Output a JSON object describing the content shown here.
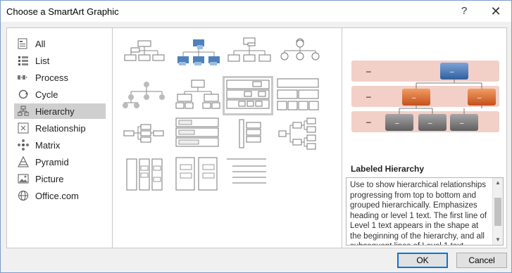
{
  "window": {
    "title": "Choose a SmartArt Graphic",
    "help_glyph": "?",
    "close_glyph": "✕"
  },
  "categories": [
    {
      "label": "All",
      "icon": "all-icon"
    },
    {
      "label": "List",
      "icon": "list-icon"
    },
    {
      "label": "Process",
      "icon": "process-icon"
    },
    {
      "label": "Cycle",
      "icon": "cycle-icon"
    },
    {
      "label": "Hierarchy",
      "icon": "hierarchy-icon",
      "selected": true
    },
    {
      "label": "Relationship",
      "icon": "relationship-icon"
    },
    {
      "label": "Matrix",
      "icon": "matrix-icon"
    },
    {
      "label": "Pyramid",
      "icon": "pyramid-icon"
    },
    {
      "label": "Picture",
      "icon": "picture-icon"
    },
    {
      "label": "Office.com",
      "icon": "office-com-icon"
    }
  ],
  "selected_layout": {
    "name": "Labeled Hierarchy",
    "description": "Use to show hierarchical relationships progressing from top to bottom and grouped hierarchically. Emphasizes heading or level 1 text. The first line of Level 1 text appears in the shape at the beginning of the hierarchy, and all subsequent lines of Level 1 text"
  },
  "preview": {
    "row_labels": [
      "–",
      "–",
      "–"
    ],
    "box_label": "–"
  },
  "colors": {
    "accent_blue": "#4f81bd",
    "accent_orange": "#e06c2a",
    "gray_box": "#7f7f7f",
    "band": "#f2d0c8"
  },
  "buttons": {
    "ok": "OK",
    "cancel": "Cancel"
  }
}
